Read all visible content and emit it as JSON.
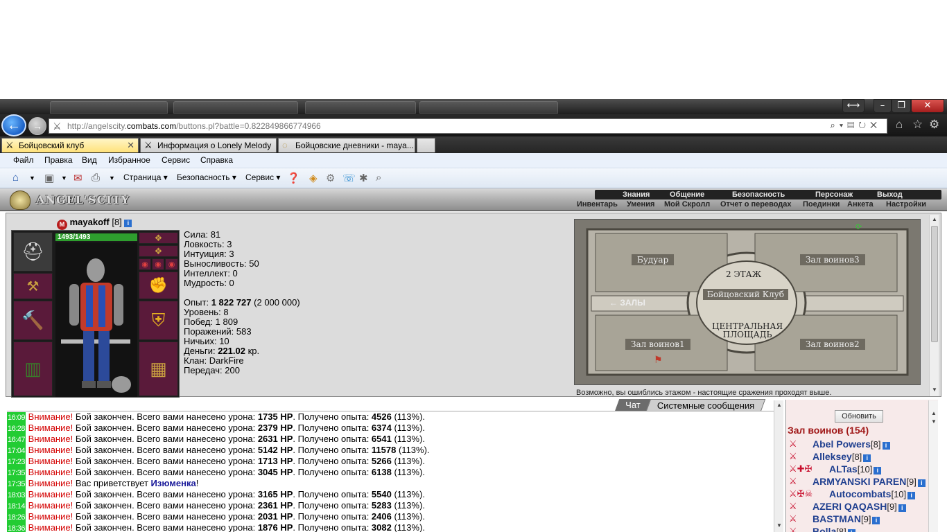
{
  "browser": {
    "url_prefix": "http://angelscity.",
    "url_domain": "combats.com",
    "url_suffix": "/buttons.pl?battle=0.822849866774966",
    "tabs": [
      {
        "label": "Бойцовский клуб",
        "active": true
      },
      {
        "label": "Информация о Lonely Melody",
        "active": false
      },
      {
        "label": "Бойцовские дневники - maya...",
        "active": false
      }
    ],
    "menu": [
      "Файл",
      "Правка",
      "Вид",
      "Избранное",
      "Сервис",
      "Справка"
    ],
    "commands": {
      "page": "Страница",
      "security": "Безопасность",
      "service": "Сервис"
    }
  },
  "game": {
    "logo_text": "ANGEL'SCITY",
    "top_nav": [
      "Знания",
      "Общение",
      "Безопасность",
      "Персонаж",
      "Выход"
    ],
    "sub_nav": [
      "Инвентарь",
      "Умения",
      "Мой Скролл",
      "Отчет о переводах",
      "Поединки",
      "Анкета",
      "Настройки"
    ],
    "character": {
      "name": "mayakoff",
      "level": "[8]",
      "hp": "1493/1493",
      "hp_fraction": 1.0,
      "stats": [
        {
          "label": "Сила: ",
          "value": "81"
        },
        {
          "label": "Ловкость: ",
          "value": "3"
        },
        {
          "label": "Интуиция: ",
          "value": "3"
        },
        {
          "label": "Выносливость: ",
          "value": "50"
        },
        {
          "label": "Интеллект: ",
          "value": "0"
        },
        {
          "label": "Мудрость: ",
          "value": "0"
        }
      ],
      "experience_label": "Опыт: ",
      "experience": "1 822 727",
      "experience_next": "(2 000 000)",
      "level_label": "Уровень: ",
      "level_value": "8",
      "wins_label": "Побед: ",
      "wins": "1 809",
      "losses_label": "Поражений: ",
      "losses": "583",
      "draws_label": "Ничьих: ",
      "draws": "10",
      "money_label": "Деньги: ",
      "money": "221.02",
      "money_unit": " кр.",
      "clan_label": "Клан: ",
      "clan": "DarkFire",
      "transfers_label": "Передач: ",
      "transfers": "200"
    },
    "map": {
      "rooms": {
        "boudoir": "Будуар",
        "hall3": "Зал воинов3",
        "floor": "2 ЭТАЖ",
        "club": "Бойцовский Клуб",
        "halls": "ЗАЛЫ",
        "square_line1": "ЦЕНТРАЛЬНАЯ",
        "square_line2": "ПЛОЩАДЬ",
        "hall1": "Зал воинов1",
        "hall2": "Зал воинов2"
      },
      "note": "Возможно, вы ошиблись этажом - настоящие сражения проходят выше."
    },
    "chat": {
      "tab_chat": "Чат",
      "tab_system": "Системные сообщения",
      "warning": "Внимание!",
      "battle_text": " Бой закончен. Всего вами нанесено урона: ",
      "exp_text": ". Получено опыта: ",
      "hp_unit": " HP",
      "greeting_text": " Вас приветствует ",
      "messages": [
        {
          "time": "16:09",
          "kind": "battle",
          "damage": "1735",
          "exp": "4526",
          "pct": " (113%)."
        },
        {
          "time": "16:28",
          "kind": "battle",
          "damage": "2379",
          "exp": "6374",
          "pct": " (113%)."
        },
        {
          "time": "16:47",
          "kind": "battle",
          "damage": "2631",
          "exp": "6541",
          "pct": " (113%)."
        },
        {
          "time": "17:04",
          "kind": "battle",
          "damage": "5142",
          "exp": "11578",
          "pct": " (113%)."
        },
        {
          "time": "17:23",
          "kind": "battle",
          "damage": "1713",
          "exp": "5266",
          "pct": " (113%)."
        },
        {
          "time": "17:35",
          "kind": "battle",
          "damage": "3045",
          "exp": "6138",
          "pct": " (113%)."
        },
        {
          "time": "17:35",
          "kind": "greet",
          "nick": "Изюменка",
          "end": "!"
        },
        {
          "time": "18:03",
          "kind": "battle",
          "damage": "3165",
          "exp": "5540",
          "pct": " (113%)."
        },
        {
          "time": "18:14",
          "kind": "battle",
          "damage": "2361",
          "exp": "5283",
          "pct": " (113%)."
        },
        {
          "time": "18:26",
          "kind": "battle",
          "damage": "2031",
          "exp": "2406",
          "pct": " (113%)."
        },
        {
          "time": "18:36",
          "kind": "battle",
          "damage": "1876",
          "exp": "3082",
          "pct": " (113%)."
        }
      ]
    },
    "online": {
      "refresh": "Обновить",
      "room": "Зал воинов (154)",
      "users": [
        {
          "name": "Abel Powers",
          "level": "[8]",
          "icons": "⚔"
        },
        {
          "name": "Alleksey",
          "level": "[8]",
          "icons": "⚔"
        },
        {
          "name": "ALTas",
          "level": "[10]",
          "icons": "⚔✚✠"
        },
        {
          "name": "ARMYANSKI PAREN",
          "level": "[9]",
          "icons": "⚔"
        },
        {
          "name": "Autocombats",
          "level": "[10]",
          "icons": "⚔✠☠"
        },
        {
          "name": "AZERI QAQASH",
          "level": "[9]",
          "icons": "⚔"
        },
        {
          "name": "BASTMAN",
          "level": "[9]",
          "icons": "⚔"
        },
        {
          "name": "Bolla",
          "level": "[8]",
          "icons": "⚔"
        }
      ]
    }
  }
}
